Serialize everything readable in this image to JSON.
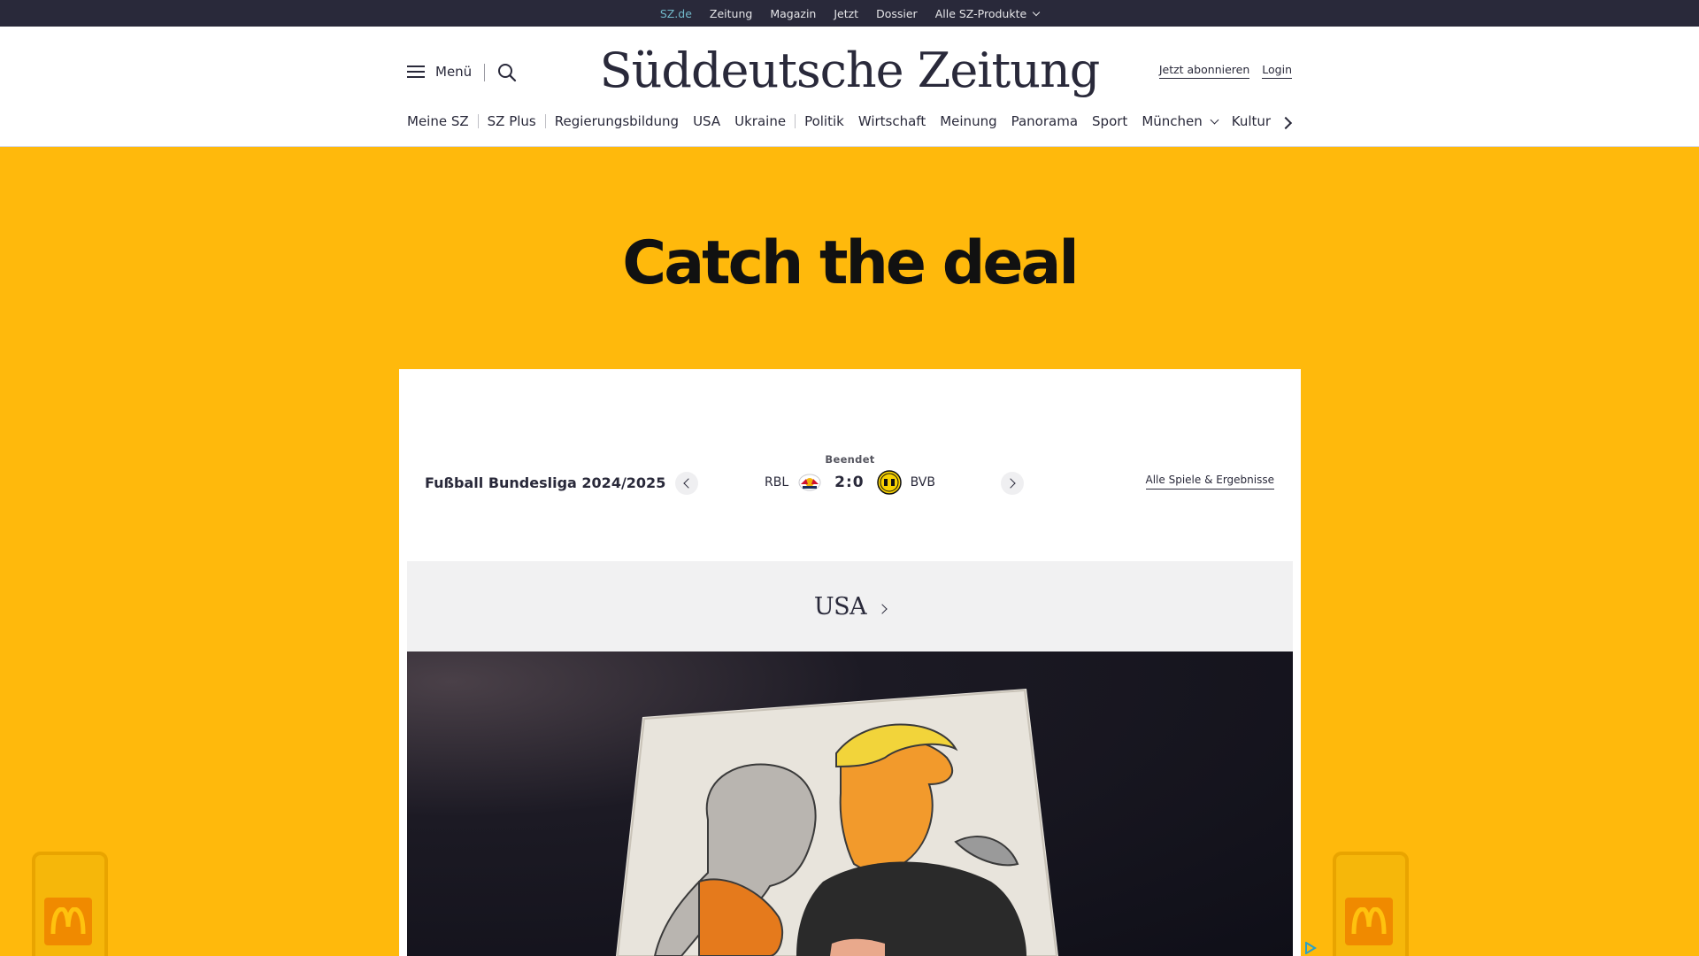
{
  "topbar": {
    "items": [
      "SZ.de",
      "Zeitung",
      "Magazin",
      "Jetzt",
      "Dossier",
      "Alle SZ-Produkte"
    ]
  },
  "header": {
    "menu_label": "Menü",
    "logo": "Süddeutsche Zeitung",
    "subscribe": "Jetzt abonnieren",
    "login": "Login"
  },
  "nav": {
    "items": [
      "Meine SZ",
      "SZ Plus",
      "Regierungsbildung",
      "USA",
      "Ukraine",
      "Politik",
      "Wirtschaft",
      "Meinung",
      "Panorama",
      "Sport",
      "München",
      "Kultur"
    ]
  },
  "hero": {
    "title": "Catch the deal"
  },
  "scoreboard": {
    "league": "Fußball Bundesliga 2024/2025",
    "status": "Beendet",
    "home": "RBL",
    "score": "2:0",
    "away": "BVB",
    "all_games": "Alle Spiele & Ergebnisse"
  },
  "section": {
    "title": "USA"
  },
  "colors": {
    "brand_dark": "#29293a",
    "ad_yellow": "#ffb90c",
    "accent_link": "#71b8c9"
  }
}
